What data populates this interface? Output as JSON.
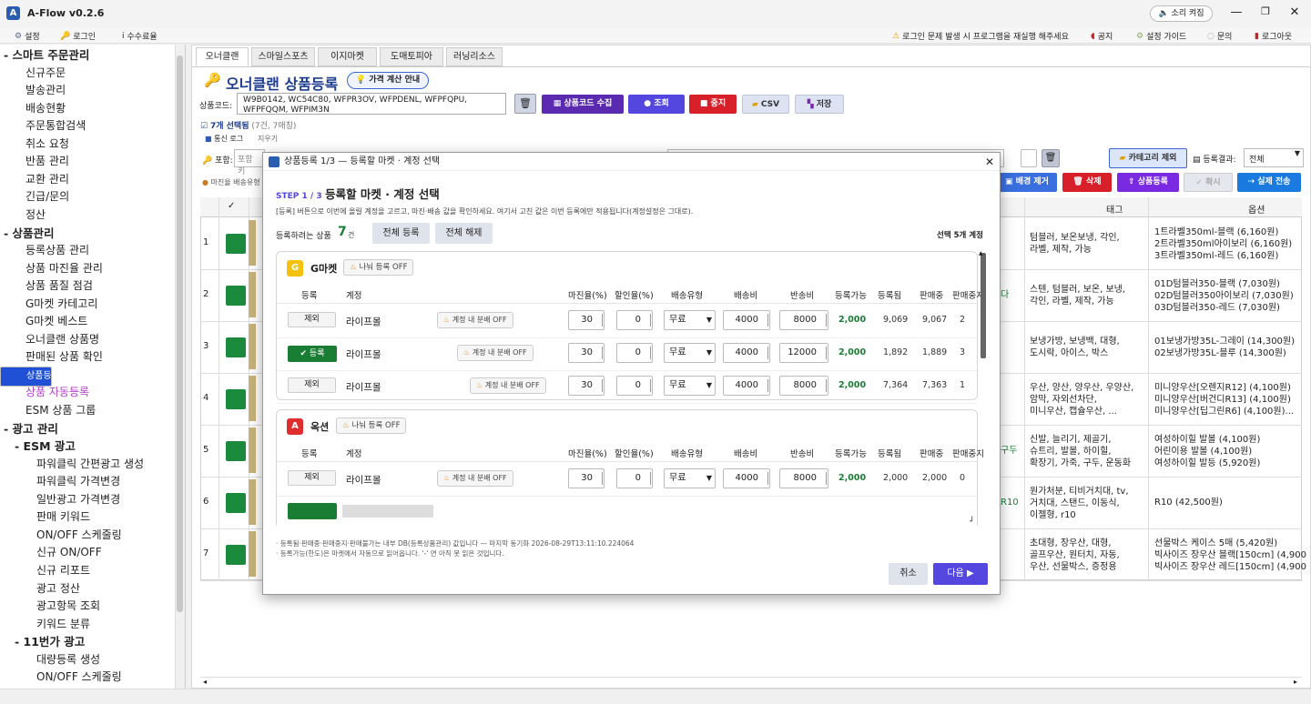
{
  "app": {
    "logo": "A",
    "title": "A-Flow v0.2.6",
    "sound_label": "소리 켜짐",
    "min": "—",
    "max": "❐",
    "close": "✕"
  },
  "menubar": {
    "settings": "설정",
    "login": "로그인",
    "fee": "수수료율",
    "notice": "로그인 문제 발생 시 프로그램을 재실행 해주세요",
    "announcement": "공지",
    "setup_guide": "설정 가이드",
    "inquiry": "문의",
    "logout": "로그아웃"
  },
  "sidebar": {
    "items": [
      {
        "label": "- 스마트 주문관리",
        "type": "h"
      },
      {
        "label": "신규주문"
      },
      {
        "label": "발송관리"
      },
      {
        "label": "배송현황"
      },
      {
        "label": "주문통합검색"
      },
      {
        "label": "취소 요청"
      },
      {
        "label": "반품 관리"
      },
      {
        "label": "교환 관리"
      },
      {
        "label": "긴급/문의"
      },
      {
        "label": "정산"
      },
      {
        "label": "- 상품관리",
        "type": "h"
      },
      {
        "label": "등록상품 관리"
      },
      {
        "label": "상품 마진율 관리"
      },
      {
        "label": "상품 품질 점검"
      },
      {
        "label": "G마켓 카테고리"
      },
      {
        "label": "G마켓 베스트"
      },
      {
        "label": "오너클랜 상품명"
      },
      {
        "label": "판매된 상품 확인"
      },
      {
        "label": "상품등록",
        "type": "sel"
      },
      {
        "label": "상품 자동등록",
        "type": "auto"
      },
      {
        "label": "ESM 상품 그룹"
      },
      {
        "label": "- 광고 관리",
        "type": "h"
      },
      {
        "label": "- ESM 광고",
        "type": "h2"
      },
      {
        "label": "파워클릭 간편광고 생성"
      },
      {
        "label": "파워클릭 가격변경"
      },
      {
        "label": "일반광고 가격변경"
      },
      {
        "label": "판매 키워드"
      },
      {
        "label": "ON/OFF 스케줄링"
      },
      {
        "label": "신규 ON/OFF"
      },
      {
        "label": "신규 리포트"
      },
      {
        "label": "광고 정산"
      },
      {
        "label": "광고항목 조회"
      },
      {
        "label": "키워드 분류"
      },
      {
        "label": "- 11번가 광고",
        "type": "h2"
      },
      {
        "label": "대량등록 생성"
      },
      {
        "label": "ON/OFF 스케줄링"
      }
    ]
  },
  "tabs": [
    "오너클랜",
    "스마일스포츠",
    "이지마켓",
    "도매토피아",
    "러닝리소스"
  ],
  "main": {
    "title": "오너클랜 상품등록",
    "price_guide": "가격 계산 안내",
    "code_label": "상품코드:",
    "codes": "W9B0142, WC54C80, WFPR3OV, WFPDENL, WFPFQPU, WFPFQQM, WFPIM3N",
    "collect": "상품코드 수집",
    "search": "조회",
    "stop": "중지",
    "csv": "CSV",
    "save": "저장",
    "selected_text": "7개 선택됨",
    "selected_sub": "(7건, 7매칭)",
    "log_label": "통신 로그",
    "log_clear": "지우기",
    "filter_label": "포함:",
    "filter_placeholder": "포함 키",
    "margin_note": "마진율 배송유형",
    "category_remove": "카테고리 제외",
    "reg_result_label": "등록결과:",
    "reg_result_value": "전체",
    "bg_remove": "배경 제거",
    "delete": "삭제",
    "product_reg": "상품등록",
    "recheck": "확시",
    "live_send": "실제 전송",
    "col_tag": "태그",
    "col_option": "옵션"
  },
  "rows": [
    {
      "n": "1",
      "tags": [
        "텀블러, 보온보냉, 각인,",
        "라벨, 제작, 가능"
      ],
      "opts": [
        "1트라벨350ml-블랙 (6,160원)",
        "2트라벨350ml아이보리 (6,160원)",
        "3트라벨350ml-레드 (6,160원)"
      ],
      "extra": ""
    },
    {
      "n": "2",
      "tags": [
        "스텐, 텀블러, 보온, 보냉,",
        "각인, 라벨, 제작, 가능"
      ],
      "opts": [
        "01D텀블러350-블랙 (7,030원)",
        "02D텀블러350아이보리 (7,030원)",
        "03D텀블러350-레드 (7,030원)"
      ],
      "extra": "다"
    },
    {
      "n": "3",
      "tags": [
        "보냉가방, 보냉백, 대형,",
        "도시락, 아이스, 박스"
      ],
      "opts": [
        "01보냉가방35L-그레이 (14,300원)",
        "02보냉가방35L-블루 (14,300원)"
      ],
      "extra": ""
    },
    {
      "n": "4",
      "tags": [
        "우산, 양산, 양우산, 우양산,",
        "암막, 자외선차단,",
        "미니우산, 캡슐우산, ..."
      ],
      "opts": [
        "미니양우산[오렌지R12] (4,100원)",
        "미니양우산[버건디R13] (4,100원)",
        "미니양우산[딥그린R6] (4,100원)..."
      ],
      "extra": ""
    },
    {
      "n": "5",
      "tags": [
        "신발, 늘리기, 제골기,",
        "슈트리, 발볼, 하이힐,",
        "확장기, 가죽, 구두, 운동화"
      ],
      "opts": [
        "여성하이힐 발볼 (4,100원)",
        "어린이용 발볼 (4,100원)",
        "여성하이힐 발등 (5,920원)"
      ],
      "extra": "구두"
    },
    {
      "n": "6",
      "tags": [
        "원가처분, 티비거치대, tv,",
        "거치대, 스탠드, 이동식,",
        "이젤형, r10"
      ],
      "opts": [
        "R10 (42,500원)"
      ],
      "extra": "R10"
    },
    {
      "n": "7",
      "tags": [
        "초대형, 장우산, 대형,",
        "골프우산, 원터치, 자동,",
        "우산, 선물박스, 증정용"
      ],
      "opts": [
        "선물박스 케이스 5매 (5,420원)",
        "빅사이즈 장우산 블랙[150cm] (4,900",
        "빅사이즈 장우산 레드[150cm] (4,900"
      ],
      "extra": ""
    }
  ],
  "dialog": {
    "title": "상품등록 1/3 — 등록할 마켓 · 계정 선택",
    "step": "STEP 1 / 3",
    "heading": "등록할 마켓 · 계정 선택",
    "desc": "[등록] 버튼으로 이번에 올릴 계정을 고르고, 마진·배송 값을 확인하세요. 여기서 고친 값은 이번 등록에만 적용됩니다(계정설정은 그대로).",
    "count_label": "등록하려는 상품",
    "count_value": "7",
    "count_unit": "건",
    "select_all": "전체 등록",
    "deselect_all": "전체 해제",
    "selected_accounts": "선택 5개 계정",
    "columns": [
      "등록",
      "계정",
      "마진율(%)",
      "할인율(%)",
      "배송유형",
      "배송비",
      "반송비",
      "등록가능",
      "등록됨",
      "판매중",
      "판매중지"
    ],
    "split_off": "나눠 등록 OFF",
    "split_in_account": "계정 내 분배 OFF",
    "exclude": "제외",
    "register": "✔ 등록",
    "markets": [
      {
        "badge": "G",
        "name": "G마켓",
        "color": "#f4c20d",
        "rows": [
          {
            "state": "제외",
            "account": "라이프몰",
            "margin": "30",
            "discount": "0",
            "ship_type": "무료",
            "ship_fee": "4000",
            "return_fee": "8000",
            "avail": "2,000",
            "registered": "9,069",
            "selling": "9,067",
            "stopped": "2"
          },
          {
            "state": "✔ 등록",
            "account": "라이프몰",
            "margin": "30",
            "discount": "0",
            "ship_type": "무료",
            "ship_fee": "4000",
            "return_fee": "12000",
            "avail": "2,000",
            "registered": "1,892",
            "selling": "1,889",
            "stopped": "3"
          },
          {
            "state": "제외",
            "account": "라이프몰",
            "margin": "30",
            "discount": "0",
            "ship_type": "무료",
            "ship_fee": "4000",
            "return_fee": "8000",
            "avail": "2,000",
            "registered": "7,364",
            "selling": "7,363",
            "stopped": "1"
          }
        ]
      },
      {
        "badge": "A",
        "name": "옥션",
        "color": "#e02d2d",
        "rows": [
          {
            "state": "제외",
            "account": "라이프몰",
            "margin": "30",
            "discount": "0",
            "ship_type": "무료",
            "ship_fee": "4000",
            "return_fee": "8000",
            "avail": "2,000",
            "registered": "2,000",
            "selling": "2,000",
            "stopped": "0"
          }
        ]
      }
    ],
    "footnote1": "· 등록됨·판매중·판매중지·판매불가는 내부 DB(등록상품관리) 값입니다 — 마지막 동기화 2026-08-29T13:11:10.224064",
    "footnote2": "· 등록가능(한도)은 마켓에서 자동으로 읽어옵니다. '-' 면 아직 못 읽은 것입니다.",
    "cancel": "취소",
    "next": "다음 ▶"
  }
}
